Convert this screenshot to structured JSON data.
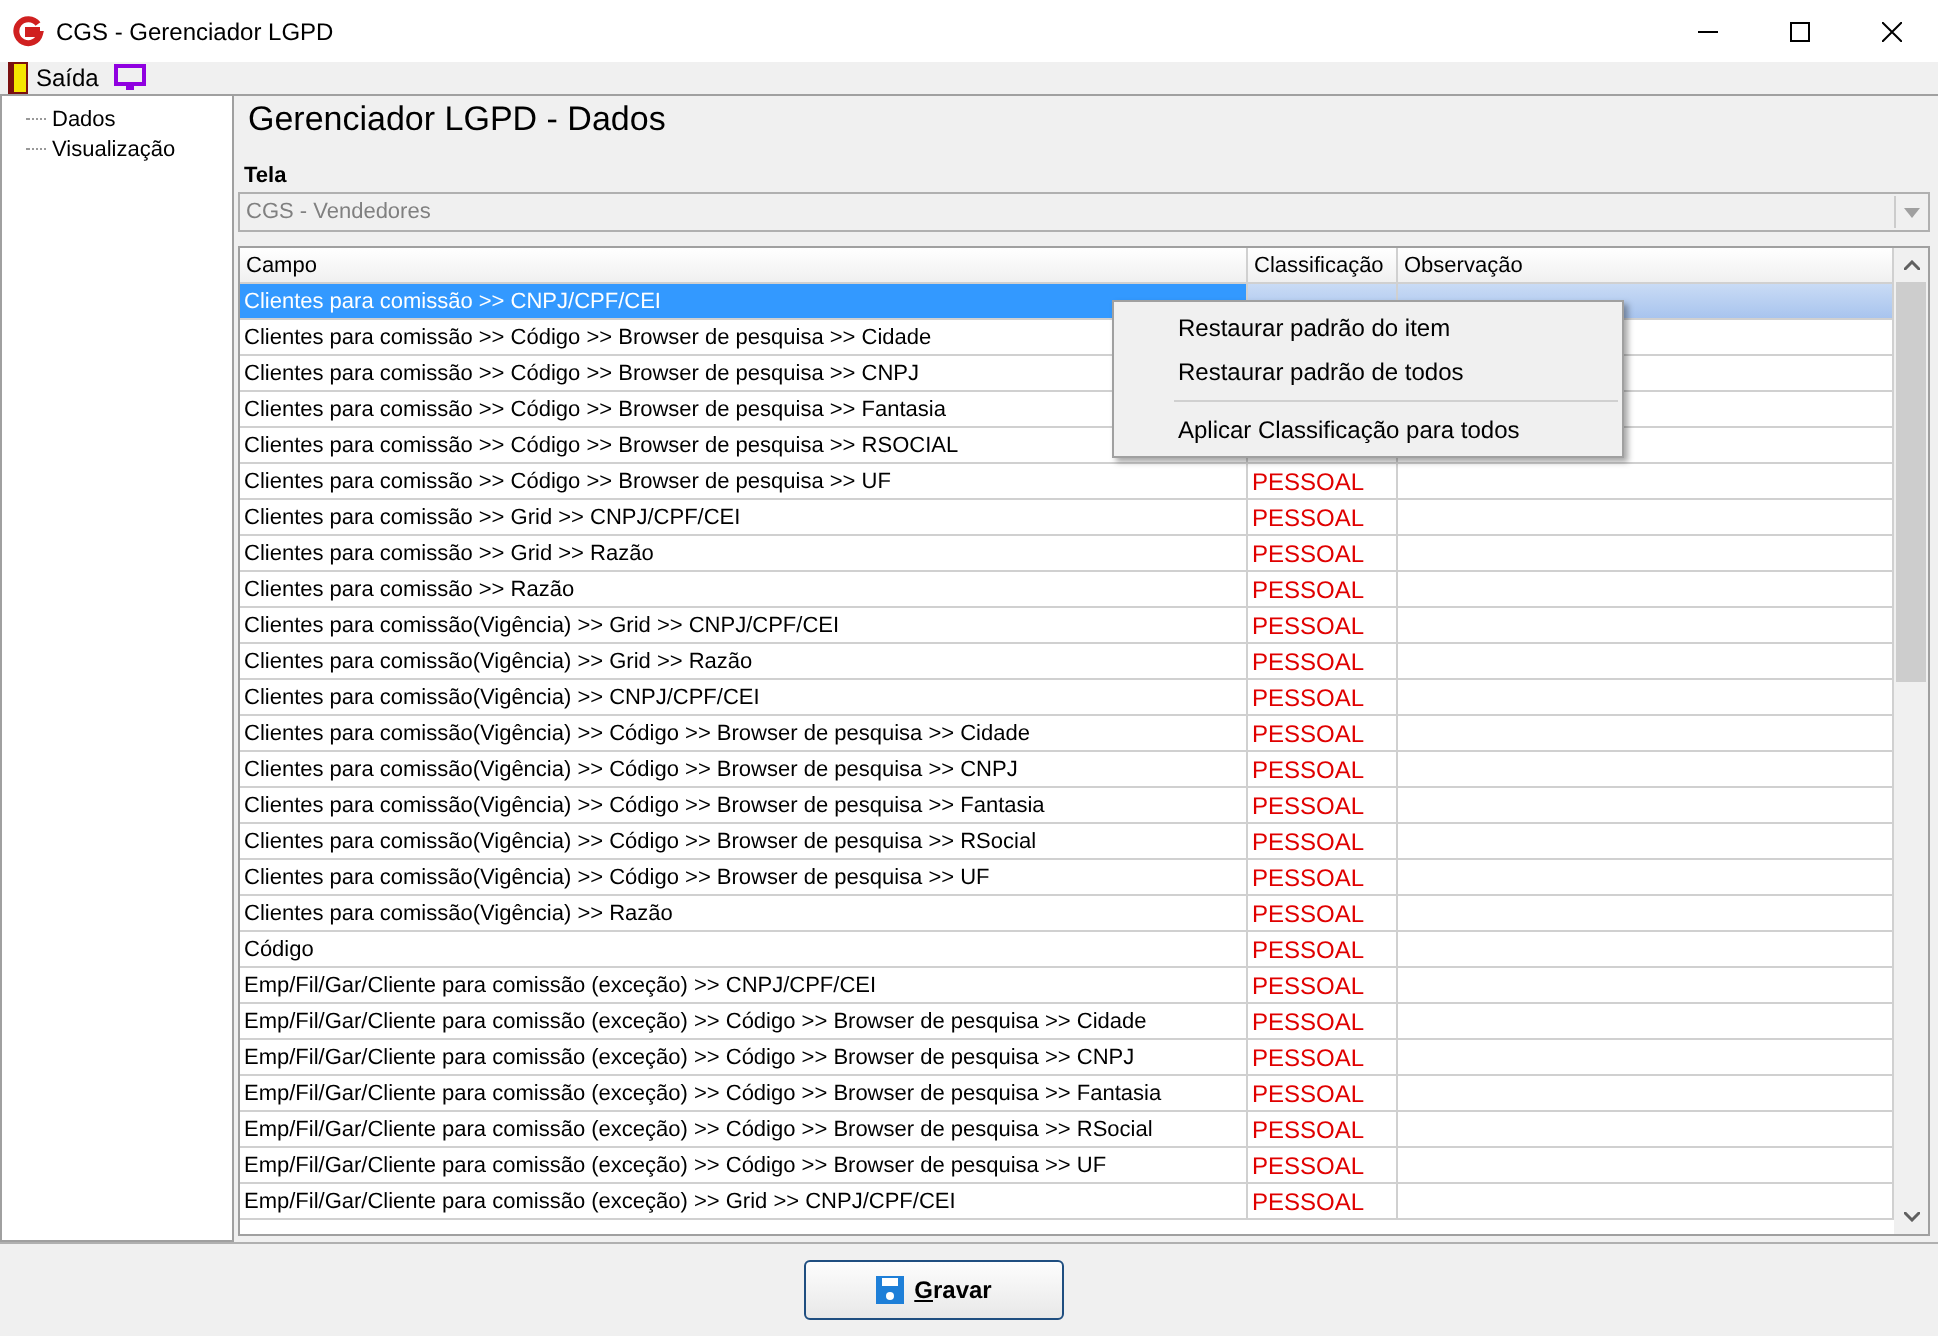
{
  "window": {
    "title": "CGS - Gerenciador LGPD"
  },
  "menu": [
    {
      "label": "Saída",
      "kind": "exit"
    },
    {
      "kind": "monitor"
    }
  ],
  "tree": [
    {
      "label": "Dados"
    },
    {
      "label": "Visualização"
    }
  ],
  "heading": "Gerenciador LGPD - Dados",
  "screen_field": {
    "label": "Tela",
    "value": "CGS - Vendedores",
    "disabled": true
  },
  "table": {
    "columns": [
      "Campo",
      "Classificação",
      "Observação"
    ],
    "rows": [
      {
        "campo": "Clientes para comissão >> CNPJ/CPF/CEI",
        "selected": true
      },
      {
        "campo": "Clientes para comissão >> Código >> Browser de pesquisa >> Cidade",
        "selected": false
      },
      {
        "campo": "Clientes para comissão >> Código >> Browser de pesquisa >> CNPJ",
        "selected": false
      },
      {
        "campo": "Clientes para comissão >> Código >> Browser de pesquisa >> Fantasia",
        "selected": false
      },
      {
        "campo": "Clientes para comissão >> Código >> Browser de pesquisa >> RSOCIAL",
        "selected": false
      },
      {
        "campo": "Clientes para comissão >> Código >> Browser de pesquisa >> UF",
        "classificacao": "PESSOAL",
        "selected": false
      },
      {
        "campo": "Clientes para comissão >> Grid >> CNPJ/CPF/CEI",
        "classificacao": "PESSOAL",
        "selected": false
      },
      {
        "campo": "Clientes para comissão >> Grid >> Razão",
        "classificacao": "PESSOAL",
        "selected": false
      },
      {
        "campo": "Clientes para comissão >> Razão",
        "classificacao": "PESSOAL",
        "selected": false
      },
      {
        "campo": "Clientes para comissão(Vigência)  >> Grid >> CNPJ/CPF/CEI",
        "classificacao": "PESSOAL",
        "selected": false
      },
      {
        "campo": "Clientes para comissão(Vigência)  >> Grid >> Razão",
        "classificacao": "PESSOAL",
        "selected": false
      },
      {
        "campo": "Clientes para comissão(Vigência) >> CNPJ/CPF/CEI",
        "classificacao": "PESSOAL",
        "selected": false
      },
      {
        "campo": "Clientes para comissão(Vigência) >> Código >> Browser de pesquisa >> Cidade",
        "classificacao": "PESSOAL",
        "selected": false
      },
      {
        "campo": "Clientes para comissão(Vigência) >> Código >> Browser de pesquisa >> CNPJ",
        "classificacao": "PESSOAL",
        "selected": false
      },
      {
        "campo": "Clientes para comissão(Vigência) >> Código >> Browser de pesquisa >> Fantasia",
        "classificacao": "PESSOAL",
        "selected": false
      },
      {
        "campo": "Clientes para comissão(Vigência) >> Código >> Browser de pesquisa >> RSocial",
        "classificacao": "PESSOAL",
        "selected": false
      },
      {
        "campo": "Clientes para comissão(Vigência) >> Código >> Browser de pesquisa >> UF",
        "classificacao": "PESSOAL",
        "selected": false
      },
      {
        "campo": "Clientes para comissão(Vigência) >> Razão",
        "classificacao": "PESSOAL",
        "selected": false
      },
      {
        "campo": "Código",
        "classificacao": "PESSOAL",
        "selected": false
      },
      {
        "campo": "Emp/Fil/Gar/Cliente para comissão (exceção) >> CNPJ/CPF/CEI",
        "classificacao": "PESSOAL",
        "selected": false
      },
      {
        "campo": "Emp/Fil/Gar/Cliente para comissão (exceção) >> Código >> Browser de pesquisa >> Cidade",
        "classificacao": "PESSOAL",
        "selected": false
      },
      {
        "campo": "Emp/Fil/Gar/Cliente para comissão (exceção) >> Código >> Browser de pesquisa >> CNPJ",
        "classificacao": "PESSOAL",
        "selected": false
      },
      {
        "campo": "Emp/Fil/Gar/Cliente para comissão (exceção) >> Código >> Browser de pesquisa >> Fantasia",
        "classificacao": "PESSOAL",
        "selected": false
      },
      {
        "campo": "Emp/Fil/Gar/Cliente para comissão (exceção) >> Código >> Browser de pesquisa >> RSocial",
        "classificacao": "PESSOAL",
        "selected": false
      },
      {
        "campo": "Emp/Fil/Gar/Cliente para comissão (exceção) >> Código >> Browser de pesquisa >> UF",
        "classificacao": "PESSOAL",
        "selected": false
      },
      {
        "campo": "Emp/Fil/Gar/Cliente para comissão (exceção) >> Grid >> CNPJ/CPF/CEI",
        "classificacao": "PESSOAL",
        "selected": false
      }
    ]
  },
  "context_menu": [
    {
      "label": "Restaurar padrão do item",
      "kind": "item"
    },
    {
      "label": "Restaurar padrão de todos",
      "kind": "item"
    },
    {
      "kind": "separator"
    },
    {
      "label": "Aplicar Classificação para todos",
      "kind": "item"
    }
  ],
  "save_button": {
    "label": "Gravar"
  }
}
